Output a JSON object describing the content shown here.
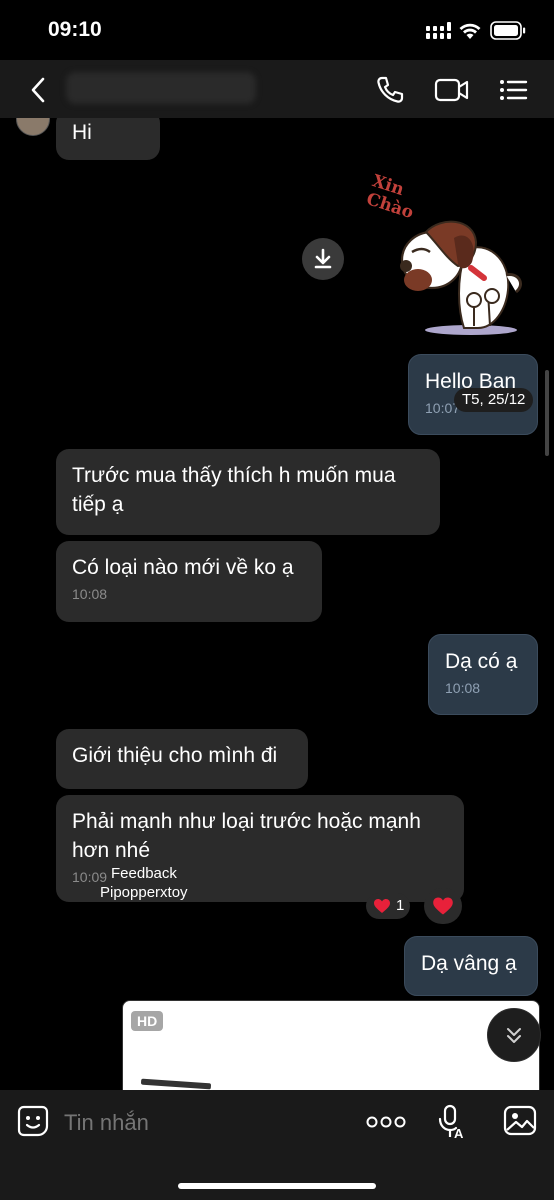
{
  "status_bar": {
    "time": "09:10"
  },
  "header": {
    "contact_name": ""
  },
  "messages": [
    {
      "side": "received",
      "text": "Hi",
      "time": ""
    },
    {
      "side": "sent",
      "text": "Hello Ban",
      "time": "10:07",
      "date_badge": "T5, 25/12"
    },
    {
      "side": "received",
      "text": "Trước mua thấy thích h muốn mua tiếp ạ",
      "time": ""
    },
    {
      "side": "received",
      "text": "Có loại nào mới về ko ạ",
      "time": "10:08"
    },
    {
      "side": "sent",
      "text": "Dạ có ạ",
      "time": "10:08"
    },
    {
      "side": "received",
      "text": "Giới thiệu cho mình đi",
      "time": ""
    },
    {
      "side": "received",
      "text": "Phải mạnh như loại trước hoặc mạnh hơn nhé",
      "time": "10:09",
      "overlay_line1": "Feedback",
      "overlay_line2": "Pipopperxtoy",
      "reaction_count": "1"
    },
    {
      "side": "sent",
      "text": "Dạ vâng ạ",
      "time": ""
    }
  ],
  "sticker": {
    "caption": "Xin Chào"
  },
  "image_card": {
    "badge": "HD"
  },
  "composer": {
    "placeholder": "Tin nhắn"
  },
  "colors": {
    "received_bubble": "#2b2b2b",
    "sent_bubble": "#2c3a48",
    "heart": "#e8213a"
  }
}
